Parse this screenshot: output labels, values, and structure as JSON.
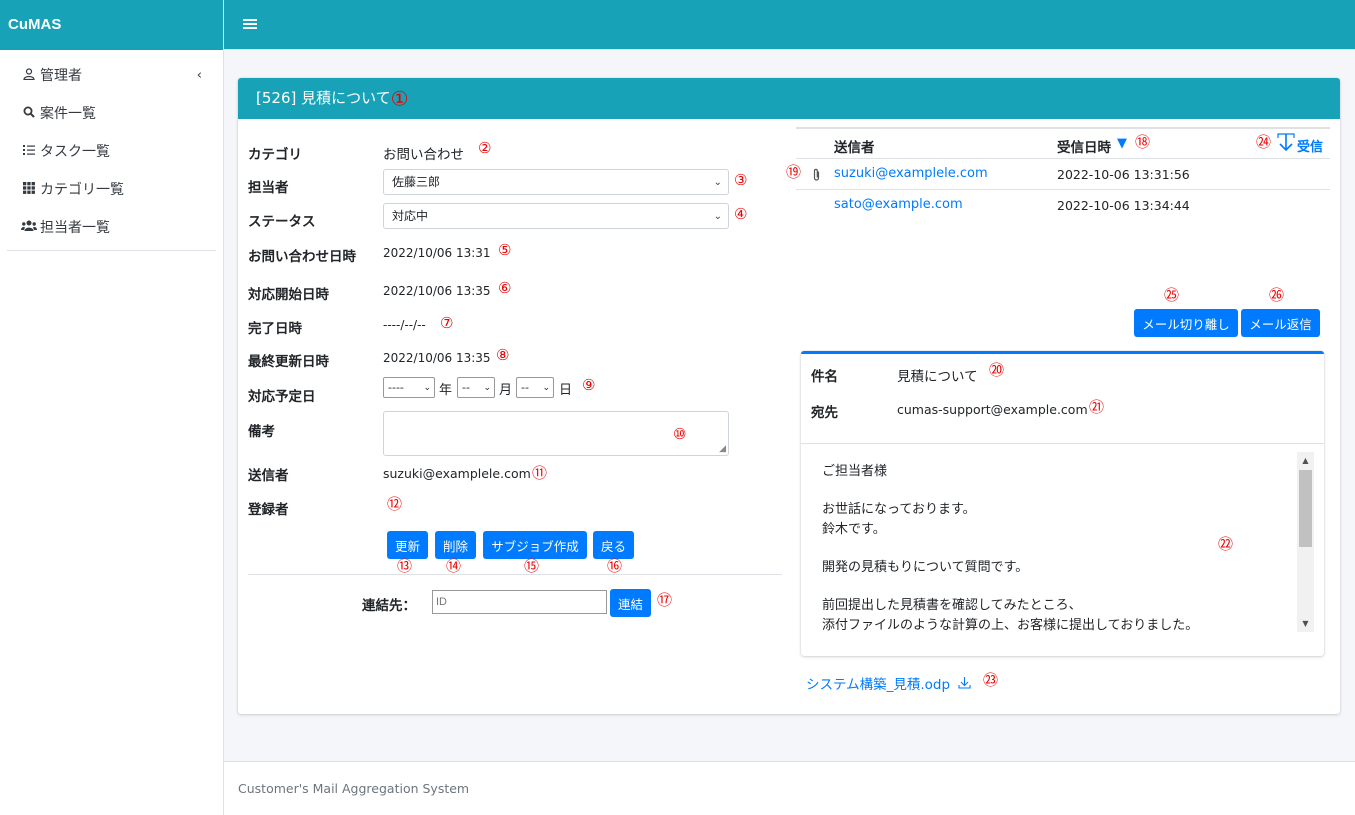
{
  "app": {
    "brand": "CuMAS"
  },
  "sidebar": {
    "items": [
      {
        "label": "管理者",
        "icon": "user-icon"
      },
      {
        "label": "案件一覧",
        "icon": "search-icon"
      },
      {
        "label": "タスク一覧",
        "icon": "tasks-icon"
      },
      {
        "label": "カテゴリ一覧",
        "icon": "grid-icon"
      },
      {
        "label": "担当者一覧",
        "icon": "users-icon"
      }
    ]
  },
  "card": {
    "title": "[526] 見積について",
    "marker": "①"
  },
  "form": {
    "category": {
      "label": "カテゴリ",
      "value": "お問い合わせ",
      "marker": "②"
    },
    "assignee": {
      "label": "担当者",
      "value": "佐藤三郎",
      "marker": "③"
    },
    "status": {
      "label": "ステータス",
      "value": "対応中",
      "marker": "④"
    },
    "inquiry_date": {
      "label": "お問い合わせ日時",
      "value": "2022/10/06 13:31",
      "marker": "⑤"
    },
    "start_date": {
      "label": "対応開始日時",
      "value": "2022/10/06 13:35",
      "marker": "⑥"
    },
    "done_date": {
      "label": "完了日時",
      "value": "----/--/--",
      "marker": "⑦"
    },
    "updated_date": {
      "label": "最終更新日時",
      "value": "2022/10/06 13:35",
      "marker": "⑧"
    },
    "planned_date": {
      "label": "対応予定日",
      "year": "----",
      "year_unit": "年",
      "month": "--",
      "month_unit": "月",
      "day": "--",
      "day_unit": "日",
      "marker": "⑨"
    },
    "notes": {
      "label": "備考",
      "value": "",
      "marker": "⑩"
    },
    "sender": {
      "label": "送信者",
      "value": "suzuki@examplele.com",
      "marker": "⑪"
    },
    "registrant": {
      "label": "登録者",
      "value": "",
      "marker": "⑫"
    }
  },
  "actions": {
    "update": {
      "label": "更新",
      "marker": "⑬"
    },
    "delete": {
      "label": "削除",
      "marker": "⑭"
    },
    "subjob": {
      "label": "サブジョブ作成",
      "marker": "⑮"
    },
    "back": {
      "label": "戻る",
      "marker": "⑯"
    }
  },
  "link_form": {
    "label": "連結先：",
    "placeholder": "ID",
    "button": "連結",
    "marker": "⑰"
  },
  "mail_list": {
    "col_sender": "送信者",
    "col_received": "受信日時",
    "sort_icon": "▼",
    "sort_marker": "⑱",
    "receive_label": "受信",
    "receive_marker": "㉔",
    "attachment_marker": "⑲",
    "rows": [
      {
        "sender": "suzuki@examplele.com",
        "received": "2022-10-06 13:31:56",
        "has_attachment": true
      },
      {
        "sender": "sato@example.com",
        "received": "2022-10-06 13:34:44",
        "has_attachment": false
      }
    ],
    "detach_button": {
      "label": "メール切り離し",
      "marker": "㉕"
    },
    "reply_button": {
      "label": "メール返信",
      "marker": "㉖"
    }
  },
  "mail_detail": {
    "subject_label": "件名",
    "subject": "見積について",
    "subject_marker": "⑳",
    "to_label": "宛先",
    "to": "cumas-support@example.com",
    "to_marker": "㉑",
    "body": "ご担当者様\n\nお世話になっております。\n鈴木です。\n\n開発の見積もりについて質問です。\n\n前回提出した見積書を確認してみたところ、\n添付ファイルのような計算の上、お客様に提出しておりました。",
    "body_marker": "㉒",
    "attachment": "システム構築_見積.odp",
    "attachment_marker": "㉓"
  },
  "footer": {
    "text": "Customer's Mail Aggregation System"
  },
  "colors": {
    "header": "#17a2b8",
    "primary": "#007bff",
    "marker": "#ee0000"
  }
}
